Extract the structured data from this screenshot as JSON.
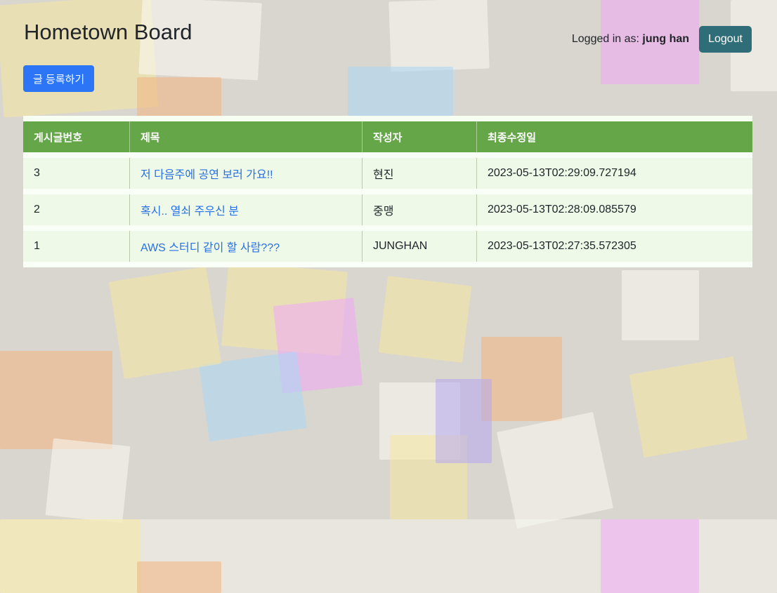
{
  "header": {
    "title": "Hometown Board",
    "logged_in_prefix": "Logged in as:",
    "username": "jung han",
    "logout_label": "Logout"
  },
  "toolbar": {
    "write_label": "글 등록하기"
  },
  "board": {
    "columns": [
      "게시글번호",
      "제목",
      "작성자",
      "최종수정일"
    ],
    "rows": [
      {
        "id": "3",
        "title": "저 다음주에 공연 보러 가요!!",
        "author": "현진",
        "modified": "2023-05-13T02:29:09.727194"
      },
      {
        "id": "2",
        "title": "혹시.. 열쇠 주우신 분",
        "author": "중맹",
        "modified": "2023-05-13T02:28:09.085579"
      },
      {
        "id": "1",
        "title": "AWS 스터디 같이 할 사람???",
        "author": "JUNGHAN",
        "modified": "2023-05-13T02:27:35.572305"
      }
    ]
  },
  "colors": {
    "header_green": "#64a648",
    "row_green": "#eef9e8",
    "link_blue": "#2870e6",
    "write_button": "#2b75f6",
    "logout_button": "#2f6e78"
  },
  "background": "sticky-notes-collage"
}
